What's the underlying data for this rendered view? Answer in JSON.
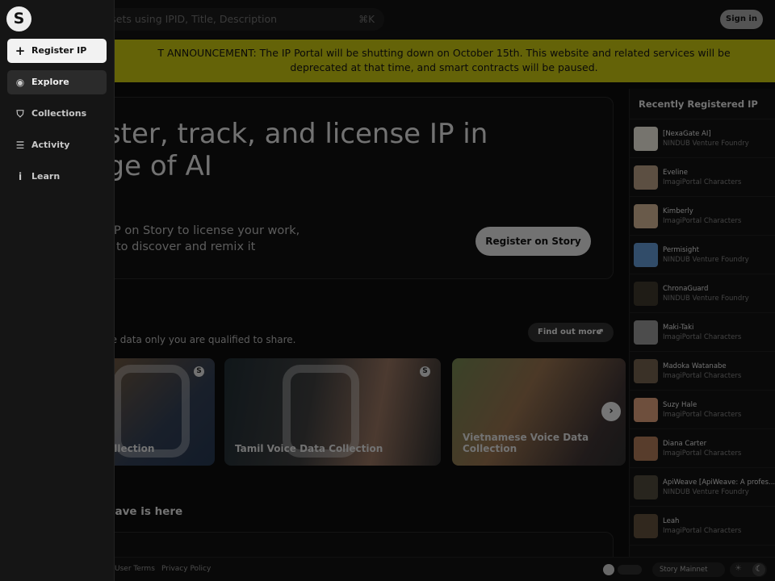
{
  "search": {
    "placeholder": "r assets using IPID, Title, Description",
    "shortcut": "⌘K"
  },
  "header": {
    "signin_label": "Sign in"
  },
  "announcement": "T ANNOUNCEMENT: The IP Portal will be shutting down on October 15th. This website and related services will be deprecated at that time, and smart contracts will be paused.",
  "sidebar": {
    "logo": "S",
    "items": [
      {
        "label": "Register IP",
        "icon": "plus-icon"
      },
      {
        "label": "Explore",
        "icon": "compass-icon"
      },
      {
        "label": "Collections",
        "icon": "collections-icon"
      },
      {
        "label": "Activity",
        "icon": "list-icon"
      },
      {
        "label": "Learn",
        "icon": "info-icon"
      }
    ]
  },
  "hero": {
    "title_line1": "egister, track, and license IP in",
    "title_line2": "e age of AI",
    "subtitle_line1": "er your IP on Story to license your work,",
    "subtitle_line2": "v others to discover and remix it",
    "cta": "Register on Story"
  },
  "data_section": {
    "description": "he data only you are qualified to share.",
    "find_out": "Find out more",
    "cards": [
      {
        "label": "ollection"
      },
      {
        "label": "Tamil Voice Data Collection"
      },
      {
        "label": "Vietnamese Voice Data Collection"
      }
    ],
    "badge": "S"
  },
  "wave": {
    "title": "wave is here"
  },
  "recent": {
    "title": "Recently Registered IP",
    "items": [
      {
        "name": "[NexaGate AI]",
        "org": "NINDUB Venture Foundry",
        "color": "#d8d4c8"
      },
      {
        "name": "Eveline",
        "org": "ImagiPortal Characters",
        "color": "#a89078"
      },
      {
        "name": "Kimberly",
        "org": "ImagiPortal Characters",
        "color": "#c0a488"
      },
      {
        "name": "Permisight",
        "org": "NINDUB Venture Foundry",
        "color": "#5a8ac0"
      },
      {
        "name": "ChronaGuard",
        "org": "NINDUB Venture Foundry",
        "color": "#3a3428"
      },
      {
        "name": "Maki-Taki",
        "org": "ImagiPortal Characters",
        "color": "#8a8a8a"
      },
      {
        "name": "Madoka Watanabe",
        "org": "ImagiPortal Characters",
        "color": "#6a5a48"
      },
      {
        "name": "Suzy Hale",
        "org": "ImagiPortal Characters",
        "color": "#c89070"
      },
      {
        "name": "Diana Carter",
        "org": "ImagiPortal Characters",
        "color": "#a07050"
      },
      {
        "name": "ApiWeave [ApiWeave: A profes...",
        "org": "NINDUB Venture Foundry",
        "color": "#4a4438"
      },
      {
        "name": "Leah",
        "org": "ImagiPortal Characters",
        "color": "#5a4a38"
      }
    ]
  },
  "footer": {
    "user_terms": "User Terms",
    "privacy": "Privacy Policy",
    "network": "Story Mainnet"
  }
}
